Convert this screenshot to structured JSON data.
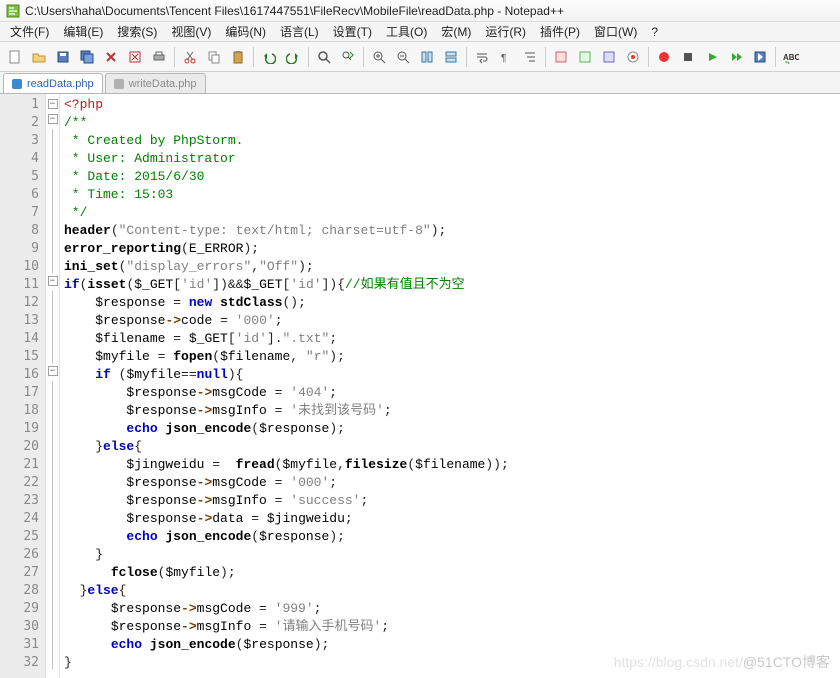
{
  "window": {
    "title": "C:\\Users\\haha\\Documents\\Tencent Files\\1617447551\\FileRecv\\MobileFile\\readData.php - Notepad++"
  },
  "menu": {
    "file": "文件(F)",
    "edit": "编辑(E)",
    "search": "搜索(S)",
    "view": "视图(V)",
    "encoding": "编码(N)",
    "language": "语言(L)",
    "settings": "设置(T)",
    "tools": "工具(O)",
    "macro": "宏(M)",
    "run": "运行(R)",
    "plugins": "插件(P)",
    "window": "窗口(W)",
    "help": "?"
  },
  "tabs": {
    "active": "readData.php",
    "inactive": "writeData.php"
  },
  "lines": [
    "1",
    "2",
    "3",
    "4",
    "5",
    "6",
    "7",
    "8",
    "9",
    "10",
    "11",
    "12",
    "13",
    "14",
    "15",
    "16",
    "17",
    "18",
    "19",
    "20",
    "21",
    "22",
    "23",
    "24",
    "25",
    "26",
    "27",
    "28",
    "29",
    "30",
    "31",
    "32"
  ],
  "code": {
    "l1_open": "<?php",
    "l2": "/**",
    "l3": " * Created by PhpStorm.",
    "l4": " * User: Administrator",
    "l5": " * Date: 2015/6/30",
    "l6": " * Time: 15:03",
    "l7": " */",
    "l8_fn": "header",
    "l8_str": "\"Content-type: text/html; charset=utf-8\"",
    "l9_fn": "error_reporting",
    "l9_arg": "E_ERROR",
    "l10_fn": "ini_set",
    "l10_a": "\"display_errors\"",
    "l10_b": "\"Off\"",
    "l11_if": "if",
    "l11_isset": "isset",
    "l11_get": "$_GET",
    "l11_key": "'id'",
    "l11_comm": "//如果有值且不为空",
    "l12_var": "$response",
    "l12_new": "new",
    "l12_cls": "stdClass",
    "l13_var": "$response",
    "l13_prop": "code",
    "l13_val": "'000'",
    "l14_var": "$filename",
    "l14_get": "$_GET",
    "l14_key": "'id'",
    "l14_ext": "\".txt\"",
    "l15_var": "$myfile",
    "l15_fn": "fopen",
    "l15_a": "$filename",
    "l15_b": "\"r\"",
    "l16_if": "if",
    "l16_var": "$myfile",
    "l16_null": "null",
    "l17_var": "$response",
    "l17_prop": "msgCode",
    "l17_val": "'404'",
    "l18_var": "$response",
    "l18_prop": "msgInfo",
    "l18_val": "'未找到该号码'",
    "l19_echo": "echo",
    "l19_fn": "json_encode",
    "l19_arg": "$response",
    "l20_else": "else",
    "l21_var": "$jingweidu",
    "l21_fn": "fread",
    "l21_a": "$myfile",
    "l21_fs": "filesize",
    "l21_b": "$filename",
    "l22_var": "$response",
    "l22_prop": "msgCode",
    "l22_val": "'000'",
    "l23_var": "$response",
    "l23_prop": "msgInfo",
    "l23_val": "'success'",
    "l24_var": "$response",
    "l24_prop": "data",
    "l24_val": "$jingweidu",
    "l25_echo": "echo",
    "l25_fn": "json_encode",
    "l25_arg": "$response",
    "l27_fn": "fclose",
    "l27_arg": "$myfile",
    "l28_else": "else",
    "l29_var": "$response",
    "l29_prop": "msgCode",
    "l29_val": "'999'",
    "l30_var": "$response",
    "l30_prop": "msgInfo",
    "l30_val": "'请输入手机号码'",
    "l31_echo": "echo",
    "l31_fn": "json_encode",
    "l31_arg": "$response"
  },
  "watermark": {
    "faint": "https://blog.csdn.net/",
    "main": "@51CTO博客"
  }
}
